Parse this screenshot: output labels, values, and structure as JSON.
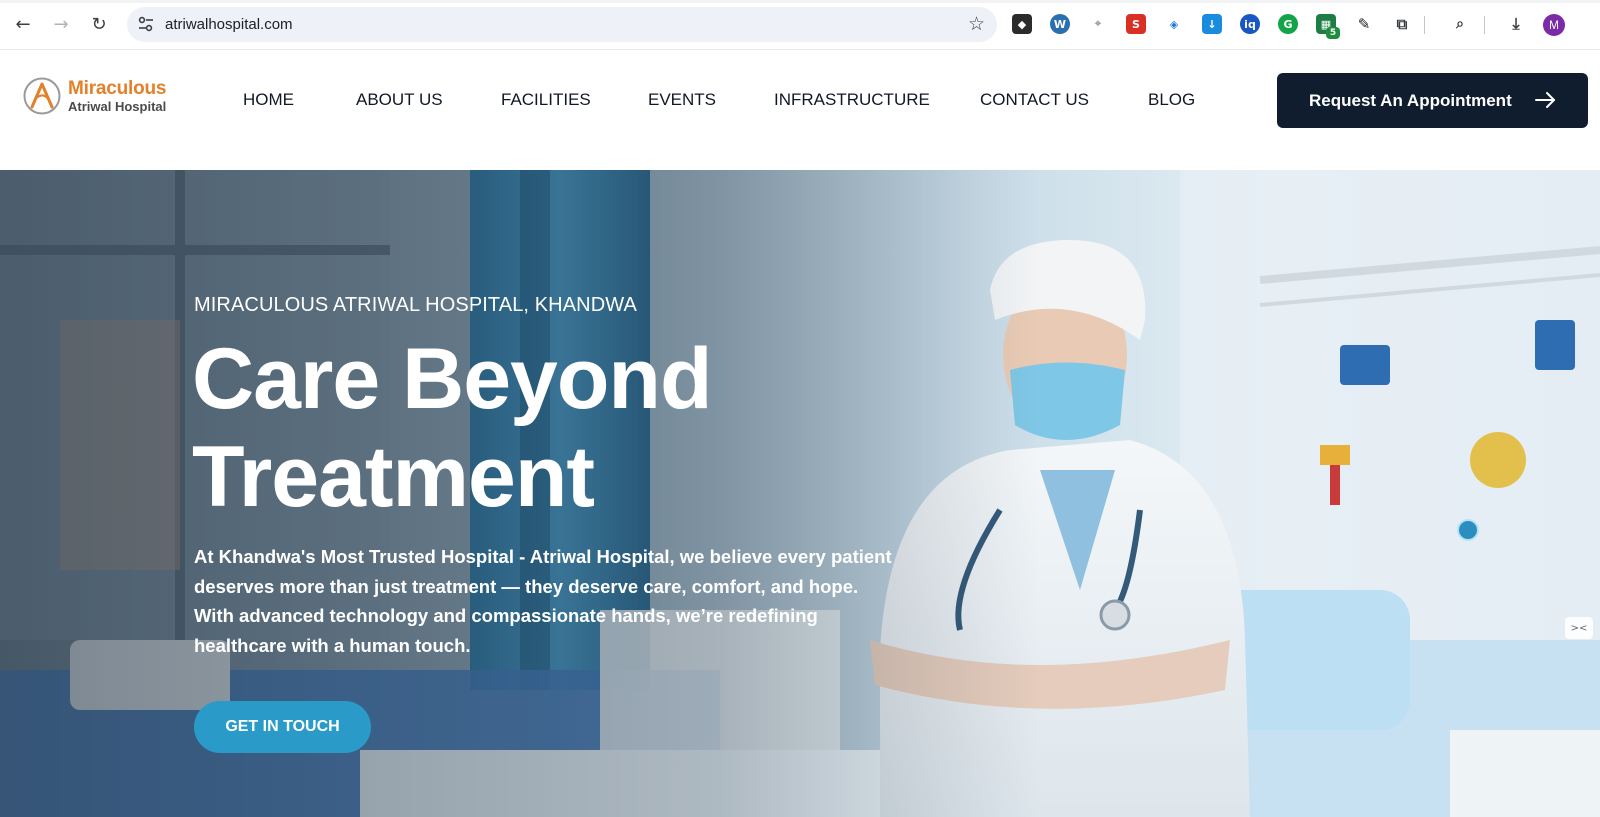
{
  "browser": {
    "url": "atriwalhospital.com",
    "extension_badge": "5",
    "profile_initial": "M",
    "icons": [
      "back-icon",
      "forward-icon",
      "reload-icon",
      "site-settings-icon",
      "bookmark-star-icon",
      "downloads-icon",
      "extensions-icon",
      "search-tabs-icon"
    ]
  },
  "header": {
    "logo": {
      "line1": "Miraculous",
      "line2": "Atriwal Hospital",
      "mark_letter": "A"
    },
    "menu": [
      "HOME",
      "ABOUT US",
      "FACILITIES",
      "EVENTS",
      "INFRASTRUCTURE",
      "CONTACT US",
      "BLOG"
    ],
    "cta_label": "Request An Appointment"
  },
  "hero": {
    "eyebrow": "MIRACULOUS ATRIWAL HOSPITAL, KHANDWA",
    "headline_line1": "Care Beyond",
    "headline_line2": "Treatment",
    "lede": "At Khandwa's Most Trusted Hospital - Atriwal Hospital, we believe every patient deserves more than just treatment — they deserve care, comfort, and hope. With advanced technology and compassionate hands, we’re redefining healthcare with a human touch.",
    "button_label": "GET IN TOUCH"
  },
  "colors": {
    "brand_orange": "#e3812a",
    "cta_navy": "#0f1d2e",
    "accent_blue": "#2a9bc9"
  }
}
